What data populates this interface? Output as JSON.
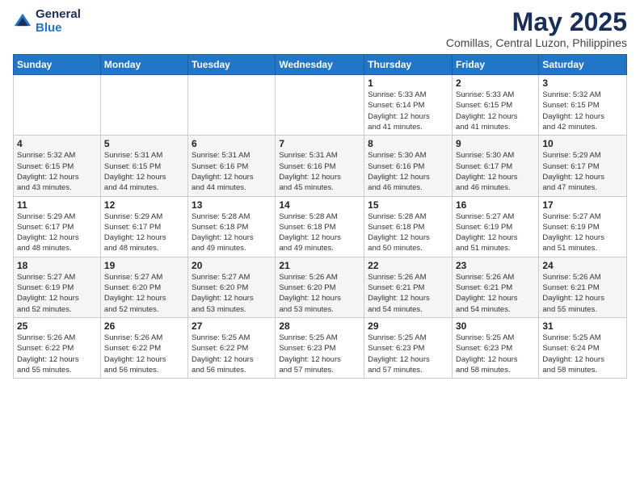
{
  "header": {
    "logo_line1": "General",
    "logo_line2": "Blue",
    "title": "May 2025",
    "subtitle": "Comillas, Central Luzon, Philippines"
  },
  "weekdays": [
    "Sunday",
    "Monday",
    "Tuesday",
    "Wednesday",
    "Thursday",
    "Friday",
    "Saturday"
  ],
  "weeks": [
    [
      {
        "day": "",
        "info": ""
      },
      {
        "day": "",
        "info": ""
      },
      {
        "day": "",
        "info": ""
      },
      {
        "day": "",
        "info": ""
      },
      {
        "day": "1",
        "info": "Sunrise: 5:33 AM\nSunset: 6:14 PM\nDaylight: 12 hours\nand 41 minutes."
      },
      {
        "day": "2",
        "info": "Sunrise: 5:33 AM\nSunset: 6:15 PM\nDaylight: 12 hours\nand 41 minutes."
      },
      {
        "day": "3",
        "info": "Sunrise: 5:32 AM\nSunset: 6:15 PM\nDaylight: 12 hours\nand 42 minutes."
      }
    ],
    [
      {
        "day": "4",
        "info": "Sunrise: 5:32 AM\nSunset: 6:15 PM\nDaylight: 12 hours\nand 43 minutes."
      },
      {
        "day": "5",
        "info": "Sunrise: 5:31 AM\nSunset: 6:15 PM\nDaylight: 12 hours\nand 44 minutes."
      },
      {
        "day": "6",
        "info": "Sunrise: 5:31 AM\nSunset: 6:16 PM\nDaylight: 12 hours\nand 44 minutes."
      },
      {
        "day": "7",
        "info": "Sunrise: 5:31 AM\nSunset: 6:16 PM\nDaylight: 12 hours\nand 45 minutes."
      },
      {
        "day": "8",
        "info": "Sunrise: 5:30 AM\nSunset: 6:16 PM\nDaylight: 12 hours\nand 46 minutes."
      },
      {
        "day": "9",
        "info": "Sunrise: 5:30 AM\nSunset: 6:17 PM\nDaylight: 12 hours\nand 46 minutes."
      },
      {
        "day": "10",
        "info": "Sunrise: 5:29 AM\nSunset: 6:17 PM\nDaylight: 12 hours\nand 47 minutes."
      }
    ],
    [
      {
        "day": "11",
        "info": "Sunrise: 5:29 AM\nSunset: 6:17 PM\nDaylight: 12 hours\nand 48 minutes."
      },
      {
        "day": "12",
        "info": "Sunrise: 5:29 AM\nSunset: 6:17 PM\nDaylight: 12 hours\nand 48 minutes."
      },
      {
        "day": "13",
        "info": "Sunrise: 5:28 AM\nSunset: 6:18 PM\nDaylight: 12 hours\nand 49 minutes."
      },
      {
        "day": "14",
        "info": "Sunrise: 5:28 AM\nSunset: 6:18 PM\nDaylight: 12 hours\nand 49 minutes."
      },
      {
        "day": "15",
        "info": "Sunrise: 5:28 AM\nSunset: 6:18 PM\nDaylight: 12 hours\nand 50 minutes."
      },
      {
        "day": "16",
        "info": "Sunrise: 5:27 AM\nSunset: 6:19 PM\nDaylight: 12 hours\nand 51 minutes."
      },
      {
        "day": "17",
        "info": "Sunrise: 5:27 AM\nSunset: 6:19 PM\nDaylight: 12 hours\nand 51 minutes."
      }
    ],
    [
      {
        "day": "18",
        "info": "Sunrise: 5:27 AM\nSunset: 6:19 PM\nDaylight: 12 hours\nand 52 minutes."
      },
      {
        "day": "19",
        "info": "Sunrise: 5:27 AM\nSunset: 6:20 PM\nDaylight: 12 hours\nand 52 minutes."
      },
      {
        "day": "20",
        "info": "Sunrise: 5:27 AM\nSunset: 6:20 PM\nDaylight: 12 hours\nand 53 minutes."
      },
      {
        "day": "21",
        "info": "Sunrise: 5:26 AM\nSunset: 6:20 PM\nDaylight: 12 hours\nand 53 minutes."
      },
      {
        "day": "22",
        "info": "Sunrise: 5:26 AM\nSunset: 6:21 PM\nDaylight: 12 hours\nand 54 minutes."
      },
      {
        "day": "23",
        "info": "Sunrise: 5:26 AM\nSunset: 6:21 PM\nDaylight: 12 hours\nand 54 minutes."
      },
      {
        "day": "24",
        "info": "Sunrise: 5:26 AM\nSunset: 6:21 PM\nDaylight: 12 hours\nand 55 minutes."
      }
    ],
    [
      {
        "day": "25",
        "info": "Sunrise: 5:26 AM\nSunset: 6:22 PM\nDaylight: 12 hours\nand 55 minutes."
      },
      {
        "day": "26",
        "info": "Sunrise: 5:26 AM\nSunset: 6:22 PM\nDaylight: 12 hours\nand 56 minutes."
      },
      {
        "day": "27",
        "info": "Sunrise: 5:25 AM\nSunset: 6:22 PM\nDaylight: 12 hours\nand 56 minutes."
      },
      {
        "day": "28",
        "info": "Sunrise: 5:25 AM\nSunset: 6:23 PM\nDaylight: 12 hours\nand 57 minutes."
      },
      {
        "day": "29",
        "info": "Sunrise: 5:25 AM\nSunset: 6:23 PM\nDaylight: 12 hours\nand 57 minutes."
      },
      {
        "day": "30",
        "info": "Sunrise: 5:25 AM\nSunset: 6:23 PM\nDaylight: 12 hours\nand 58 minutes."
      },
      {
        "day": "31",
        "info": "Sunrise: 5:25 AM\nSunset: 6:24 PM\nDaylight: 12 hours\nand 58 minutes."
      }
    ]
  ]
}
